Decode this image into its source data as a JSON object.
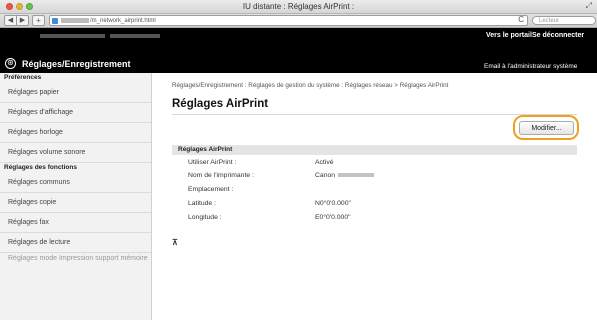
{
  "window": {
    "title": "IU distante : Réglages AirPrint :",
    "resize_glyph": "⤢"
  },
  "browser": {
    "url": "/m_network_airprint.html",
    "reload_icon": "C",
    "search_placeholder": "Lecteur",
    "back_glyph": "◀",
    "forward_glyph": "▶",
    "add_glyph": "+"
  },
  "header": {
    "link_portal": "Vers le portail",
    "link_logout": "Se déconnecter",
    "email_admin": "Email à l'administrateur système",
    "app_title": "Réglages/Enregistrement",
    "app_icon": "⊛"
  },
  "sidebar": {
    "section1_title": "Préférences",
    "section1_items": [
      "Réglages papier",
      "Réglages d'affichage",
      "Réglages horloge",
      "Réglages volume sonore"
    ],
    "section2_title": "Réglages des fonctions",
    "section2_items": [
      "Réglages communs",
      "Réglages copie",
      "Réglages fax",
      "Réglages de lecture"
    ],
    "disabled_item": "Réglages mode Impression support mémoire"
  },
  "main": {
    "breadcrumb": "Réglages/Enregistrement : Réglages de gestion du système : Réglages réseau > Réglages AirPrint",
    "page_title": "Réglages AirPrint",
    "modify_button": "Modifier...",
    "panel_title": "Réglages AirPrint",
    "rows": [
      {
        "label": "Utiliser AirPrint :",
        "value": "Activé"
      },
      {
        "label": "Nom de l'imprimante :",
        "value": "Canon"
      },
      {
        "label": "Emplacement :",
        "value": ""
      },
      {
        "label": "Latitude :",
        "value": "N0°0'0.000\""
      },
      {
        "label": "Longitude :",
        "value": "E0°0'0.000\""
      }
    ],
    "top_icon": "⊼"
  },
  "colors": {
    "header_bg": "#000000",
    "highlight_ring": "#f0a020",
    "sidebar_bg": "#f2f2f2"
  }
}
